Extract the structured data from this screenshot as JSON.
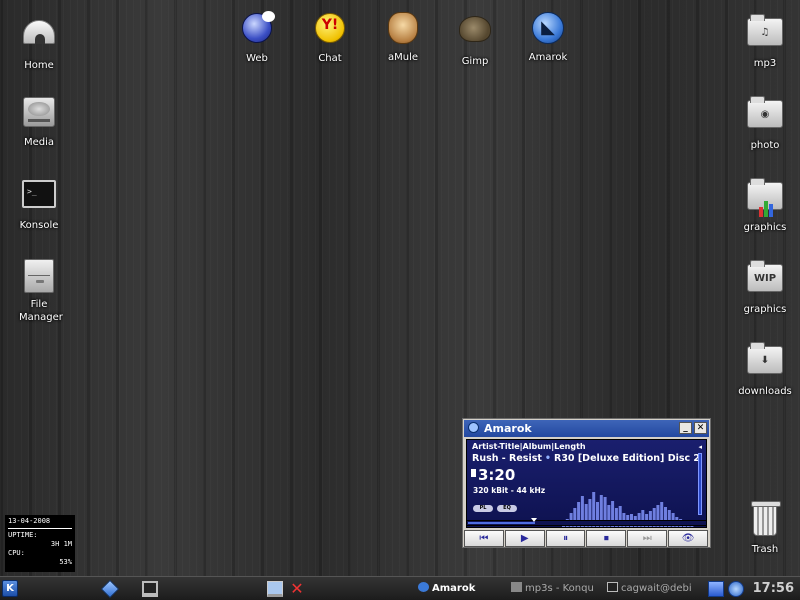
{
  "desktop": {
    "left_icons": [
      {
        "label": "Home",
        "icon": "igloo-icon"
      },
      {
        "label": "Media",
        "icon": "drive-icon"
      },
      {
        "label": "Konsole",
        "icon": "terminal-icon"
      },
      {
        "label": "File Manager",
        "icon": "file-cabinet-icon"
      }
    ],
    "top_icons": [
      {
        "label": "Web",
        "icon": "globe-icon"
      },
      {
        "label": "Chat",
        "icon": "yahoo-smiley-icon",
        "glyph": "Y!"
      },
      {
        "label": "aMule",
        "icon": "mule-icon"
      },
      {
        "label": "Gimp",
        "icon": "gimp-icon"
      },
      {
        "label": "Amarok",
        "icon": "amarok-wolf-icon"
      }
    ],
    "right_icons": [
      {
        "label": "mp3",
        "icon": "music-folder-icon",
        "glyph": "♫"
      },
      {
        "label": "photo",
        "icon": "camera-folder-icon",
        "glyph": "◉"
      },
      {
        "label": "graphics",
        "icon": "chart-folder-icon"
      },
      {
        "label": "graphics",
        "icon": "wip-folder-icon",
        "glyph": "WIP"
      },
      {
        "label": "downloads",
        "icon": "download-folder-icon",
        "glyph": "⬇"
      },
      {
        "label": "Trash",
        "icon": "trash-icon"
      }
    ]
  },
  "sysmon": {
    "date": "13-04-2008",
    "uptime_label": "UPTIME:",
    "uptime_value": "3H 1M",
    "cpu_label": "CPU:",
    "cpu_value": "53%"
  },
  "amarok": {
    "title": "Amarok",
    "minimize": "_",
    "close": "✕",
    "columns": "Artist-Title|Album|Length",
    "artist_title": "Rush - Resist",
    "separator": "•",
    "album": "R30 [Deluxe Edition] Disc 2",
    "time": "3:20",
    "bitrate": "320 kBit - 44 kHz",
    "pl_label": "PL",
    "eq_label": "EQ",
    "progress": 0.28,
    "spectrum": [
      0.15,
      0.3,
      0.45,
      0.55,
      0.7,
      0.82,
      0.65,
      0.75,
      0.9,
      0.7,
      0.85,
      0.8,
      0.62,
      0.72,
      0.55,
      0.6,
      0.45,
      0.4,
      0.42,
      0.38,
      0.45,
      0.5,
      0.42,
      0.48,
      0.55,
      0.62,
      0.7,
      0.58,
      0.5,
      0.45,
      0.35,
      0.3,
      0.22,
      0.2,
      0.16,
      0.12
    ],
    "controls": [
      {
        "name": "previous-button",
        "glyph": "⏮",
        "dim": false
      },
      {
        "name": "play-button",
        "glyph": "▶",
        "dim": false
      },
      {
        "name": "pause-button",
        "glyph": "⏸",
        "dim": false
      },
      {
        "name": "stop-button",
        "glyph": "⏹",
        "dim": false
      },
      {
        "name": "next-button",
        "glyph": "⏭",
        "dim": true
      },
      {
        "name": "visualization-button",
        "glyph": "👁",
        "dim": false
      }
    ]
  },
  "taskbar": {
    "kmenu": "K",
    "tasks": [
      {
        "label": "Amarok",
        "icon": "amarok-task-icon"
      },
      {
        "label": "mp3s - Konqu",
        "icon": "konqueror-task-icon"
      },
      {
        "label": "cagwait@debi",
        "icon": "konsole-task-icon"
      }
    ],
    "clock": "17:56",
    "colors": {
      "accent": "#2348a0",
      "spectrum": "#6f7fe0"
    }
  }
}
